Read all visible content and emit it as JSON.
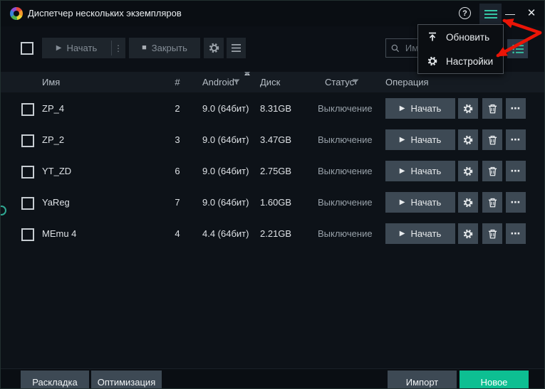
{
  "titlebar": {
    "title": "Диспетчер нескольких экземпляров",
    "help_label": "?",
    "minimize_label": "—",
    "close_label": "✕"
  },
  "toolbar": {
    "start_label": "Начать",
    "close_label": "Закрыть",
    "search_placeholder": "Им"
  },
  "menu": {
    "refresh_label": "Обновить",
    "settings_label": "Настройки"
  },
  "table": {
    "headers": {
      "name": "Имя",
      "index": "#",
      "android": "Android",
      "disk": "Диск",
      "status": "Статус",
      "operation": "Операция"
    },
    "row_start_label": "Начать",
    "rows": [
      {
        "name": "ZP_4",
        "index": "2",
        "android": "9.0 (64бит)",
        "disk": "8.31GB",
        "status": "Выключение"
      },
      {
        "name": "ZP_2",
        "index": "3",
        "android": "9.0 (64бит)",
        "disk": "3.47GB",
        "status": "Выключение"
      },
      {
        "name": "YT_ZD",
        "index": "6",
        "android": "9.0 (64бит)",
        "disk": "2.75GB",
        "status": "Выключение"
      },
      {
        "name": "YaReg",
        "index": "7",
        "android": "9.0 (64бит)",
        "disk": "1.60GB",
        "status": "Выключение"
      },
      {
        "name": "MEmu 4",
        "index": "4",
        "android": "4.4 (64бит)",
        "disk": "2.21GB",
        "status": "Выключение"
      }
    ]
  },
  "footer": {
    "layout_label": "Раскладка",
    "optimize_label": "Оптимизация",
    "import_label": "Импорт",
    "new_label": "Новое"
  },
  "colors": {
    "accent_green": "#0dbf92",
    "icon_teal": "#35c7a5",
    "arrow_red": "#ea1507"
  }
}
